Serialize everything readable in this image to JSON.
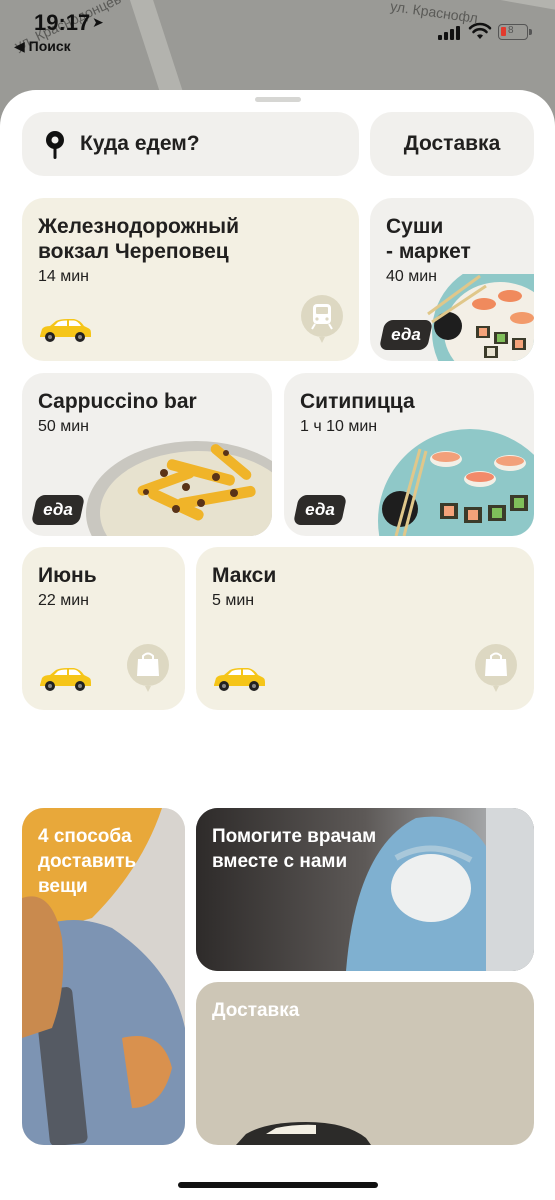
{
  "status_bar": {
    "time": "19:17",
    "back_label": "◀ Поиск",
    "battery_text": "8"
  },
  "map": {
    "street_1": "ул. Краснодонцев",
    "street_2": "ул. Краснофл"
  },
  "search": {
    "where_label": "Куда едем?",
    "delivery_label": "Доставка"
  },
  "shortcuts": [
    {
      "title_line1": "Железнодорожный",
      "title_line2": "вокзал Череповец",
      "time": "14 мин",
      "icon": "train-icon"
    },
    {
      "title_line1": "Суши",
      "title_line2": "- маркет",
      "time": "40 мин",
      "badge": "еда"
    },
    {
      "title_line1": "Cappuccino bar",
      "time": "50 мин",
      "badge": "еда"
    },
    {
      "title_line1": "Ситипицца",
      "time": "1 ч 10 мин",
      "badge": "еда"
    },
    {
      "title_line1": "Июнь",
      "time": "22 мин",
      "icon": "shopping-bag-icon"
    },
    {
      "title_line1": "Макси",
      "time": "5 мин",
      "icon": "shopping-bag-icon"
    }
  ],
  "promos": [
    {
      "title_line1": "4 способа",
      "title_line2": "доставить",
      "title_line3": "вещи"
    },
    {
      "title_line1": "Помогите врачам",
      "title_line2": "вместе с нами"
    },
    {
      "title_line1": "Доставка"
    }
  ],
  "colors": {
    "taxi_yellow": "#f5c518",
    "cream_card": "#f3f0e3",
    "gray_card": "#f1f0ed",
    "eda_badge": "#2d2b29"
  }
}
